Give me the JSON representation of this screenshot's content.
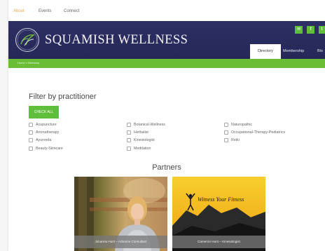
{
  "top_nav": {
    "tabs": [
      {
        "label": "About",
        "active": true
      },
      {
        "label": "Events",
        "active": false
      },
      {
        "label": "Connect",
        "active": false
      }
    ]
  },
  "header": {
    "brand": "SQUAMISH WELLNESS",
    "social": [
      {
        "icon": "mail-icon",
        "glyph": "✉"
      },
      {
        "icon": "facebook-icon",
        "glyph": "f"
      },
      {
        "icon": "twitter-icon",
        "glyph": "t"
      }
    ],
    "nav": [
      {
        "label": "Directory",
        "active": true
      },
      {
        "label": "Membership",
        "active": false
      },
      {
        "label": "Blo",
        "active": false
      }
    ],
    "colors": {
      "band": "#2d2f64",
      "accent": "#5fbf3a"
    }
  },
  "breadcrumb": "Home » Directory",
  "filter": {
    "title": "Filter by practitioner",
    "check_all": "CHECK ALL",
    "columns": [
      [
        "Acupuncture",
        "Aromatherapy",
        "Ayurveda",
        "Beauty-Skincare"
      ],
      [
        "Botanical-Wellness",
        "Herbalist",
        "Kinesiologist",
        "Meditation"
      ],
      [
        "Naturopathic",
        "Occupational-Therapy-Pediatrics",
        "Reiki"
      ]
    ]
  },
  "partners": {
    "title": "Partners",
    "cards": [
      {
        "caption": "Johanna Hunt – Arbonne Consultant"
      },
      {
        "caption": "Cameron Hunt – Kinesiologist",
        "overlay_text": "Witness Your Fitness"
      }
    ]
  }
}
